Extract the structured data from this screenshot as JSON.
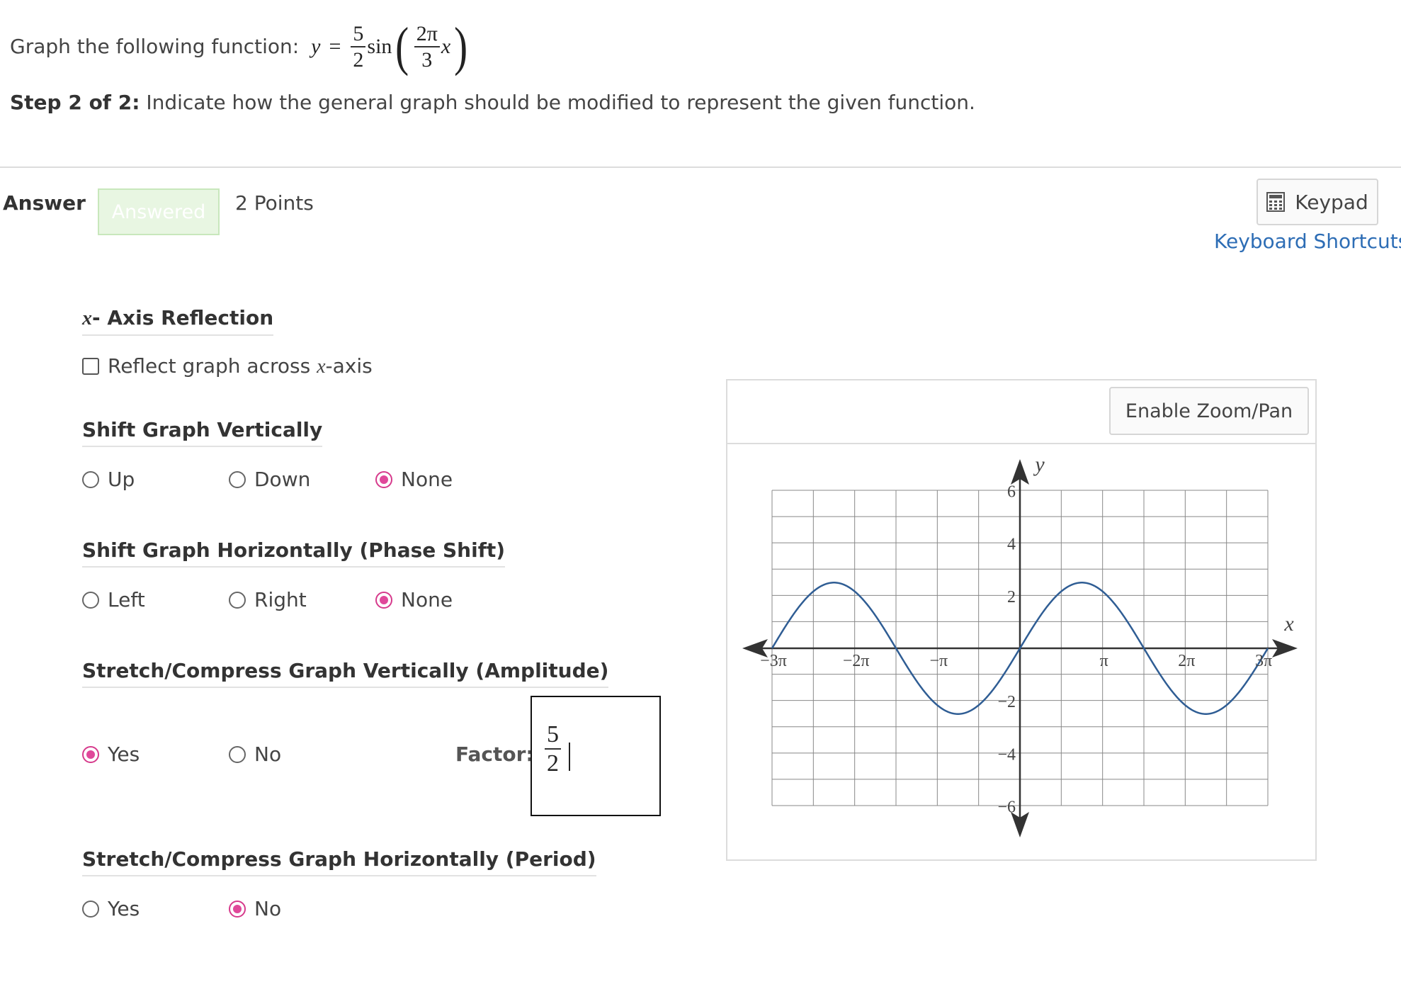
{
  "question": {
    "prompt_prefix": "Graph the following function:",
    "y_var": "y",
    "equals": "=",
    "amp_num": "5",
    "amp_den": "2",
    "fn": "sin",
    "inner_num": "2π",
    "inner_den": "3",
    "inner_var": "x",
    "step_label": "Step 2 of 2:",
    "step_text": "Indicate how the general graph should be modified to represent the given function."
  },
  "answer_bar": {
    "answer_label": "Answer",
    "status_badge": "Answered",
    "points": "2 Points",
    "keypad_label": "Keypad",
    "keyboard_shortcuts": "Keyboard Shortcuts"
  },
  "sections": {
    "reflection": {
      "title_var": "x",
      "title_rest": "- Axis Reflection",
      "checkbox_text": "Reflect graph across ",
      "checkbox_var": "x",
      "checkbox_suffix": "-axis",
      "checked": false
    },
    "vertical_shift": {
      "title": "Shift Graph Vertically",
      "options": [
        "Up",
        "Down",
        "None"
      ],
      "selected": "None"
    },
    "horizontal_shift": {
      "title": "Shift Graph Horizontally (Phase Shift)",
      "options": [
        "Left",
        "Right",
        "None"
      ],
      "selected": "None"
    },
    "amplitude": {
      "title": "Stretch/Compress Graph Vertically (Amplitude)",
      "options": [
        "Yes",
        "No"
      ],
      "selected": "Yes",
      "factor_label": "Factor:",
      "factor_num": "5",
      "factor_den": "2"
    },
    "period": {
      "title": "Stretch/Compress Graph Horizontally (Period)",
      "options": [
        "Yes",
        "No"
      ],
      "selected": "No"
    }
  },
  "graph": {
    "zoom_button": "Enable Zoom/Pan",
    "x_axis_label": "x",
    "y_axis_label": "y",
    "x_tick_labels": [
      "−3π",
      "−2π",
      "−π",
      "π",
      "2π",
      "3π"
    ],
    "y_tick_labels": [
      "6",
      "4",
      "2",
      "−2",
      "−4",
      "−6"
    ],
    "curve_color": "#2f5d94",
    "curve": {
      "function": "y = 2.5 sin(2x/3)",
      "amplitude": 2.5,
      "period": "3π",
      "x_range": "[−3π, 3π]"
    }
  },
  "colors": {
    "accent_radio": "#e0489a",
    "link": "#2d6db5",
    "answered_bg": "#e8f6e2"
  }
}
